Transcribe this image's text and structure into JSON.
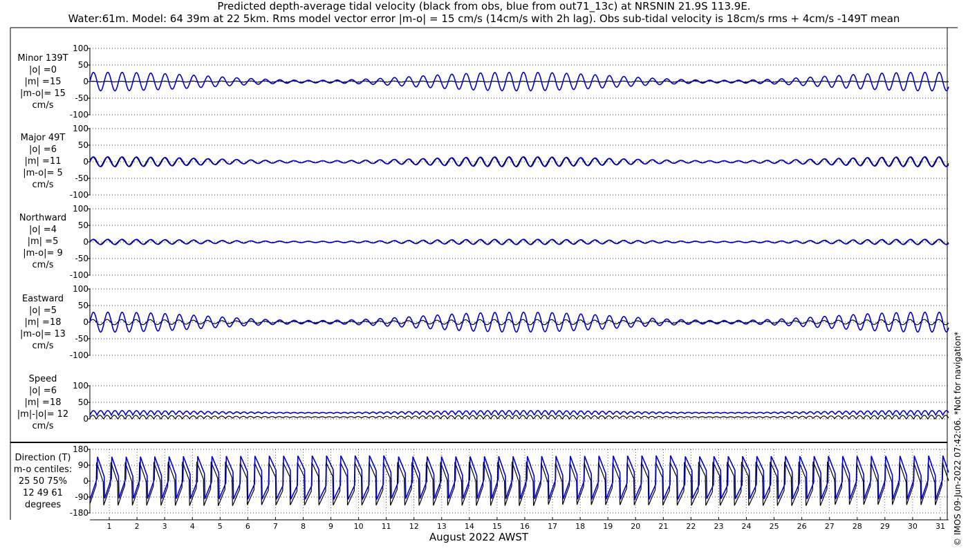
{
  "title_line1": "Predicted depth-average tidal velocity (black from obs, blue from out71_13c) at NRSNIN 21.9S 113.9E.",
  "title_line2": "Water:61m. Model: 64 39m at 22 5km. Rms model vector error |m-o| = 15 cm/s (14cm/s with 2h lag). Obs sub-tidal velocity is 18cm/s rms + 4cm/s -149T mean",
  "xlabel": "August 2022 AWST",
  "copyright": "© IMOS 09-Jun-2022 07:42:06. *Not for navigation*",
  "colors": {
    "obs": "#000000",
    "model": "#0000cc",
    "grid": "#000000"
  },
  "chart_data": [
    {
      "type": "line",
      "name": "minor",
      "label_lines": [
        "Minor 139T",
        "|o| =0",
        "|m| =15",
        "|m-o|= 15",
        "cm/s"
      ],
      "ylim": [
        -100,
        100
      ],
      "yticks": [
        "100",
        "50",
        "0",
        "-50",
        "-100"
      ],
      "series": [
        {
          "name": "obs",
          "amplitude": [
            1,
            2,
            1
          ],
          "offset": 0
        },
        {
          "name": "model",
          "amplitude": [
            28,
            4,
            28
          ],
          "offset": 0
        }
      ]
    },
    {
      "type": "line",
      "name": "major",
      "label_lines": [
        "Major 49T",
        "|o| =6",
        "|m| =11",
        "|m-o|= 5",
        "cm/s"
      ],
      "ylim": [
        -100,
        100
      ],
      "yticks": [
        "100",
        "50",
        "0",
        "-50",
        "-100"
      ],
      "series": [
        {
          "name": "obs",
          "amplitude": [
            14,
            3,
            14
          ],
          "offset": 0
        },
        {
          "name": "model",
          "amplitude": [
            15,
            3,
            18
          ],
          "offset": 0
        }
      ]
    },
    {
      "type": "line",
      "name": "northward",
      "label_lines": [
        "Northward",
        "|o| =4",
        "|m| =5",
        "|m-o|= 9",
        "cm/s"
      ],
      "ylim": [
        -100,
        100
      ],
      "yticks": [
        "100",
        "50",
        "0",
        "-50",
        "-100"
      ],
      "series": [
        {
          "name": "obs",
          "amplitude": [
            7,
            2,
            7
          ],
          "offset": 0
        },
        {
          "name": "model",
          "amplitude": [
            8,
            2,
            9
          ],
          "offset": 0
        }
      ]
    },
    {
      "type": "line",
      "name": "eastward",
      "label_lines": [
        "Eastward",
        "|o| =5",
        "|m| =18",
        "|m-o|= 13",
        "cm/s"
      ],
      "ylim": [
        -100,
        100
      ],
      "yticks": [
        "100",
        "50",
        "0",
        "-50",
        "-100"
      ],
      "series": [
        {
          "name": "obs",
          "amplitude": [
            8,
            2,
            8
          ],
          "offset": 0
        },
        {
          "name": "model",
          "amplitude": [
            30,
            5,
            33
          ],
          "offset": 0
        }
      ]
    },
    {
      "type": "line",
      "name": "speed",
      "label_lines": [
        "Speed",
        "|o| =6",
        "|m| =18",
        "|m|-|o|= 12",
        "cm/s"
      ],
      "ylim": [
        0,
        100
      ],
      "yticks": [
        "100",
        "50",
        "0"
      ],
      "series": [
        {
          "name": "obs",
          "amplitude": [
            12,
            3,
            12
          ],
          "offset": 5
        },
        {
          "name": "model",
          "amplitude": [
            14,
            3,
            14
          ],
          "offset": 18
        }
      ]
    },
    {
      "type": "line",
      "name": "direction",
      "label_lines": [
        "Direction (T)",
        "m-o centiles:",
        "25  50  75%",
        "12  49  61",
        "degrees"
      ],
      "ylim": [
        -180,
        180
      ],
      "yticks": [
        "180",
        "90",
        "0",
        "-90",
        "-180"
      ],
      "series": [
        {
          "name": "obs",
          "kind": "direction"
        },
        {
          "name": "model",
          "kind": "direction"
        }
      ]
    }
  ],
  "x_axis": {
    "days": [
      "1",
      "2",
      "3",
      "4",
      "5",
      "6",
      "7",
      "8",
      "9",
      "10",
      "11",
      "12",
      "13",
      "14",
      "15",
      "16",
      "17",
      "18",
      "19",
      "20",
      "21",
      "22",
      "23",
      "24",
      "25",
      "26",
      "27",
      "28",
      "29",
      "30",
      "31"
    ],
    "tide_period_hours": 12.42,
    "spring_neap_days": 14.77
  }
}
